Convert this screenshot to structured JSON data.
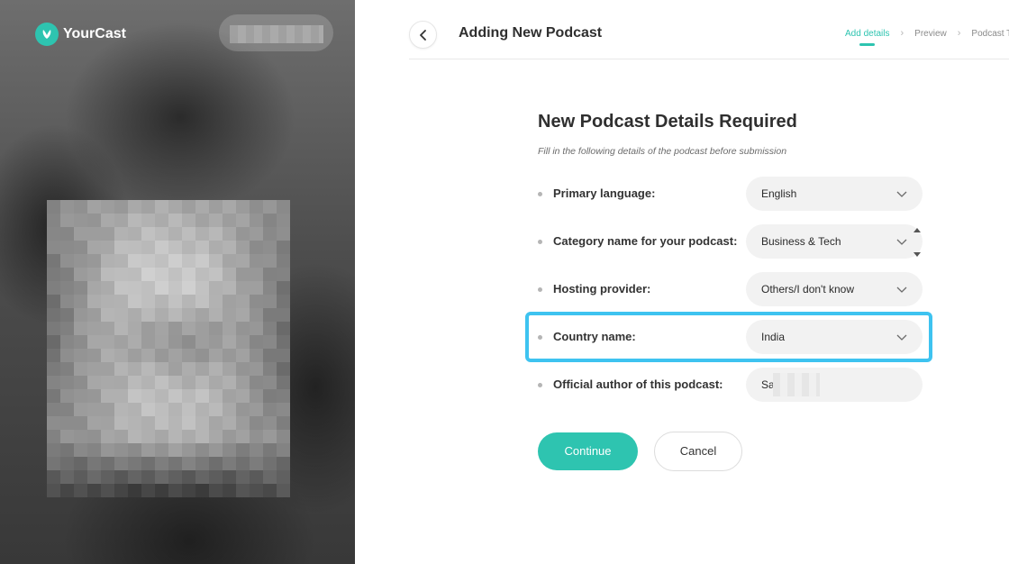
{
  "app": {
    "name": "YourCast"
  },
  "header": {
    "title": "Adding New Podcast",
    "steps": [
      {
        "label": "Add details",
        "active": true
      },
      {
        "label": "Preview",
        "active": false
      },
      {
        "label": "Podcast T",
        "active": false
      }
    ]
  },
  "form": {
    "title": "New Podcast Details Required",
    "subtitle": "Fill in the following details of the podcast before submission",
    "fields": [
      {
        "label": "Primary language:",
        "value": "English"
      },
      {
        "label": "Category name for your podcast:",
        "value": "Business & Tech"
      },
      {
        "label": "Hosting provider:",
        "value": "Others/I don't know"
      },
      {
        "label": "Country name:",
        "value": "India"
      },
      {
        "label": "Official author of this podcast:",
        "value": "Sa          na"
      }
    ]
  },
  "buttons": {
    "continue": "Continue",
    "cancel": "Cancel"
  },
  "colors": {
    "accent": "#2ec4b0",
    "highlight": "#3ec3f0"
  },
  "icons": [
    "yourcast-logo-icon",
    "back-arrow-icon",
    "chevron-right-icon",
    "chevron-down-icon",
    "scroll-arrow-up-icon",
    "scroll-arrow-down-icon"
  ]
}
